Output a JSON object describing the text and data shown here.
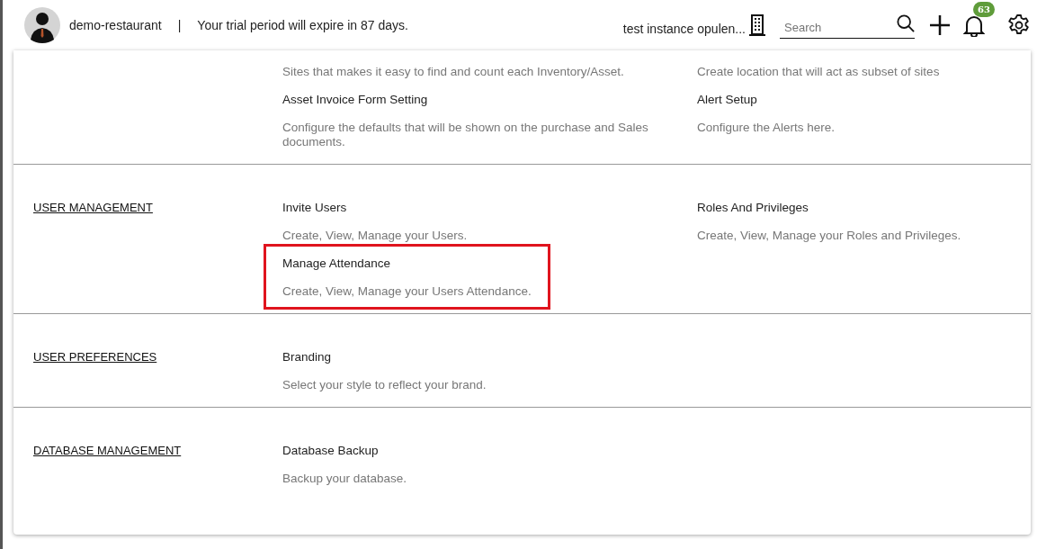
{
  "header": {
    "user_name": "demo-restaurant",
    "separator": "|",
    "trial_message": "Your trial period will expire in 87 days.",
    "instance_name": "test instance opulen...",
    "search": {
      "placeholder": "Search"
    },
    "notification_count": "63"
  },
  "sections": [
    {
      "items": [
        {
          "description": "Sites that makes it easy to find and count each Inventory/Asset.",
          "highlighted": false
        },
        {
          "description": "Create location that will act as subset of sites",
          "highlighted": false
        },
        {
          "title": "Asset Invoice Form Setting",
          "description": "Configure the defaults that will be shown on the purchase and Sales documents.",
          "highlighted": false
        },
        {
          "title": "Alert Setup",
          "description": "Configure the Alerts here.",
          "highlighted": false
        }
      ]
    },
    {
      "label": "USER MANAGEMENT",
      "items": [
        {
          "title": "Invite Users",
          "description": "Create, View, Manage your Users.",
          "highlighted": false
        },
        {
          "title": "Roles And Privileges",
          "description": "Create, View, Manage your Roles and Privileges.",
          "highlighted": false
        },
        {
          "title": "Manage Attendance",
          "description": "Create, View, Manage your Users Attendance.",
          "highlighted": true
        }
      ]
    },
    {
      "label": "USER PREFERENCES",
      "items": [
        {
          "title": "Branding",
          "description": "Select your style to reflect your brand.",
          "highlighted": false
        }
      ]
    },
    {
      "label": "DATABASE MANAGEMENT",
      "items": [
        {
          "title": "Database Backup",
          "description": "Backup your database.",
          "highlighted": false
        }
      ]
    }
  ]
}
